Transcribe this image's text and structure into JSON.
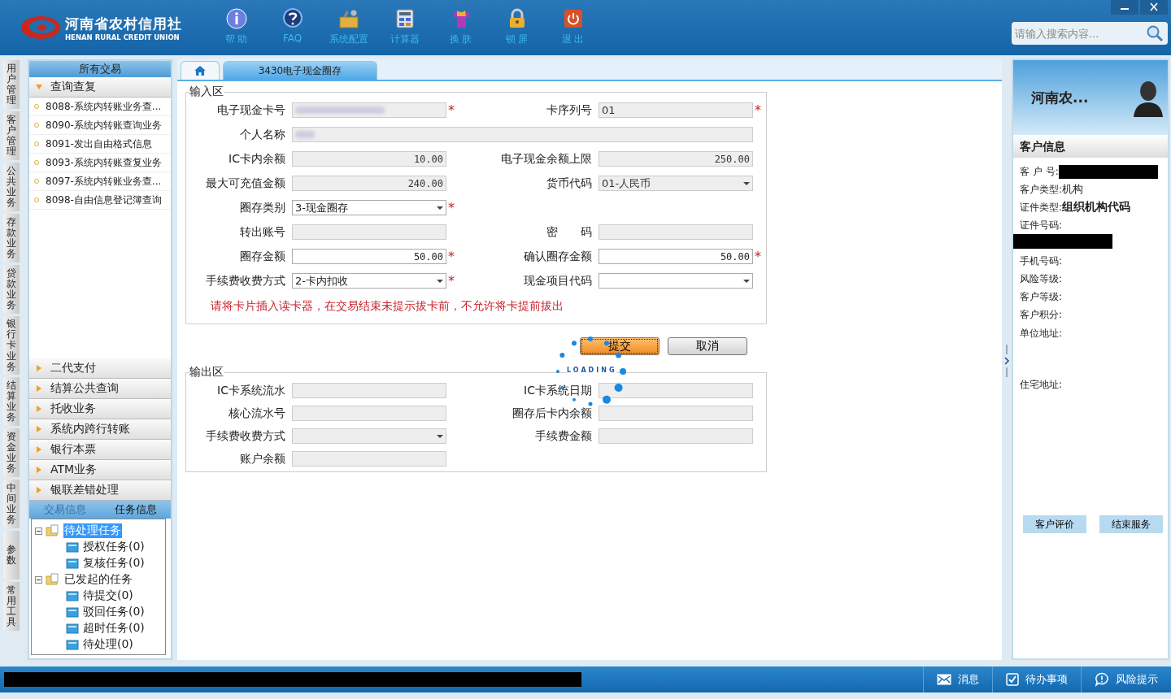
{
  "header": {
    "brand": "河南省农村信用社",
    "brand_en": "HENAN RURAL CREDIT UNION",
    "nav": [
      {
        "label": "帮 助",
        "kind": "info"
      },
      {
        "label": "FAQ",
        "kind": "faq"
      },
      {
        "label": "系统配置",
        "kind": "settings"
      },
      {
        "label": "计算器",
        "kind": "calculator"
      },
      {
        "label": "换 肤",
        "kind": "skin"
      },
      {
        "label": "锁 屏",
        "kind": "lock"
      },
      {
        "label": "退 出",
        "kind": "exit"
      }
    ],
    "search": {
      "placeholder": "请输入搜索内容..."
    }
  },
  "side_tabs": [
    "用户管理",
    "客户管理",
    "公共业务",
    "存款业务",
    "贷款业务",
    "银行卡业务",
    "结算业务",
    "资金业务",
    "中间业务",
    "参数",
    "常用工具"
  ],
  "sidebar": {
    "title": "所有交易",
    "groups": [
      {
        "label": "查询查复",
        "expanded": true,
        "items": [
          "8088-系统内转账业务查...",
          "8090-系统内转账查询业务",
          "8091-发出自由格式信息",
          "8093-系统内转账查复业务",
          "8097-系统内转账业务查...",
          "8098-自由信息登记簿查询"
        ]
      },
      {
        "label": "二代支付",
        "expanded": false
      },
      {
        "label": "结算公共查询",
        "expanded": false
      },
      {
        "label": "托收业务",
        "expanded": false
      },
      {
        "label": "系统内跨行转账",
        "expanded": false
      },
      {
        "label": "银行本票",
        "expanded": false
      },
      {
        "label": "ATM业务",
        "expanded": false
      },
      {
        "label": "银联差错处理",
        "expanded": false
      }
    ],
    "info_tabs": [
      {
        "label": "交易信息",
        "selected": false
      },
      {
        "label": "任务信息",
        "selected": true
      }
    ],
    "tree": [
      {
        "label": "待处理任务",
        "selected": true,
        "children": [
          {
            "label": "授权任务(0)",
            "selected": false
          },
          {
            "label": "复核任务(0)",
            "selected": false
          }
        ]
      },
      {
        "label": "已发起的任务",
        "selected": false,
        "children": [
          {
            "label": "待提交(0)",
            "selected": false
          },
          {
            "label": "驳回任务(0)",
            "selected": false
          },
          {
            "label": "超时任务(0)",
            "selected": false
          },
          {
            "label": "待处理(0)",
            "selected": false
          }
        ]
      }
    ]
  },
  "tabs": [
    {
      "kind": "home",
      "selected": false
    },
    {
      "kind": "page",
      "label": "3430电子现金圈存",
      "selected": true
    }
  ],
  "input_area": {
    "title": "输入区",
    "rows": [
      {
        "wide": false,
        "fields": [
          {
            "label": "电子现金卡号",
            "kind": "masked",
            "editable": false,
            "mark": "*"
          },
          {
            "label": "卡序列号",
            "kind": "text",
            "value": "01",
            "editable": false,
            "mark": "*"
          }
        ]
      },
      {
        "wide": true,
        "fields": [
          {
            "label": "个人名称",
            "kind": "masked",
            "editable": false
          }
        ]
      },
      {
        "wide": false,
        "fields": [
          {
            "label": "IC卡内余额",
            "kind": "amount",
            "value": "10.00",
            "editable": false
          },
          {
            "label": "电子现金余额上限",
            "kind": "amount",
            "value": "250.00",
            "editable": false
          }
        ]
      },
      {
        "wide": false,
        "fields": [
          {
            "label": "最大可充值金额",
            "kind": "amount",
            "value": "240.00",
            "editable": false
          },
          {
            "label": "货币代码",
            "kind": "select",
            "value": "01-人民币",
            "editable": false
          }
        ]
      },
      {
        "wide": false,
        "fields": [
          {
            "label": "圈存类别",
            "kind": "select",
            "value": "3-现金圈存",
            "editable": true,
            "mark": "*"
          }
        ]
      },
      {
        "wide": false,
        "fields": [
          {
            "label": "转出账号",
            "kind": "text",
            "editable": false
          },
          {
            "label": "密　　码",
            "kind": "text",
            "editable": false
          }
        ]
      },
      {
        "wide": false,
        "fields": [
          {
            "label": "圈存金额",
            "kind": "amount",
            "value": "50.00",
            "editable": true,
            "mark": "*"
          },
          {
            "label": "确认圈存金额",
            "kind": "amount",
            "value": "50.00",
            "editable": true,
            "mark": "*"
          }
        ]
      },
      {
        "wide": false,
        "fields": [
          {
            "label": "手续费收费方式",
            "kind": "select",
            "value": "2-卡内扣收",
            "editable": true,
            "mark": "*"
          },
          {
            "label": "现金项目代码",
            "kind": "select",
            "editable": true
          }
        ]
      }
    ],
    "notice": "请将卡片插入读卡器，在交易结束未提示拔卡前，不允许将卡提前拔出"
  },
  "actions": [
    {
      "label": "提交",
      "kind": "primary"
    },
    {
      "label": "取消",
      "kind": "normal"
    }
  ],
  "loading": "LOADING",
  "output_area": {
    "title": "输出区",
    "rows": [
      {
        "wide": false,
        "fields": [
          {
            "label": "IC卡系统流水",
            "kind": "text",
            "editable": false
          },
          {
            "label": "IC卡系统日期",
            "kind": "text",
            "editable": false
          }
        ]
      },
      {
        "wide": false,
        "fields": [
          {
            "label": "核心流水号",
            "kind": "text",
            "editable": false
          },
          {
            "label": "圈存后卡内余额",
            "kind": "text",
            "editable": false
          }
        ]
      },
      {
        "wide": false,
        "fields": [
          {
            "label": "手续费收费方式",
            "kind": "select",
            "editable": false
          },
          {
            "label": "手续费金额",
            "kind": "text",
            "editable": false
          }
        ]
      },
      {
        "wide": false,
        "fields": [
          {
            "label": "账户余额",
            "kind": "text",
            "editable": false
          }
        ]
      }
    ]
  },
  "customer": {
    "name": "河南农...",
    "title": "客户信息",
    "fields": [
      {
        "label": "客 户 号:",
        "kind": "redacted"
      },
      {
        "label": "客户类型:",
        "kind": "text",
        "value": "机构"
      },
      {
        "label": "证件类型:",
        "kind": "strong",
        "value": "组织机构代码"
      },
      {
        "label": "证件号码:",
        "kind": "redacted-below"
      },
      {
        "label": "手机号码:",
        "kind": "text"
      },
      {
        "label": "风险等级:",
        "kind": "text"
      },
      {
        "label": "客户等级:",
        "kind": "text"
      },
      {
        "label": "客户积分:",
        "kind": "text"
      },
      {
        "label": "单位地址:",
        "kind": "address"
      },
      {
        "label": "住宅地址:",
        "kind": "text"
      }
    ],
    "buttons": [
      "客户评价",
      "结束服务"
    ]
  },
  "status_bar": [
    {
      "label": "消息",
      "kind": "message"
    },
    {
      "label": "待办事项",
      "kind": "todo"
    },
    {
      "label": "风险提示",
      "kind": "risk"
    }
  ]
}
